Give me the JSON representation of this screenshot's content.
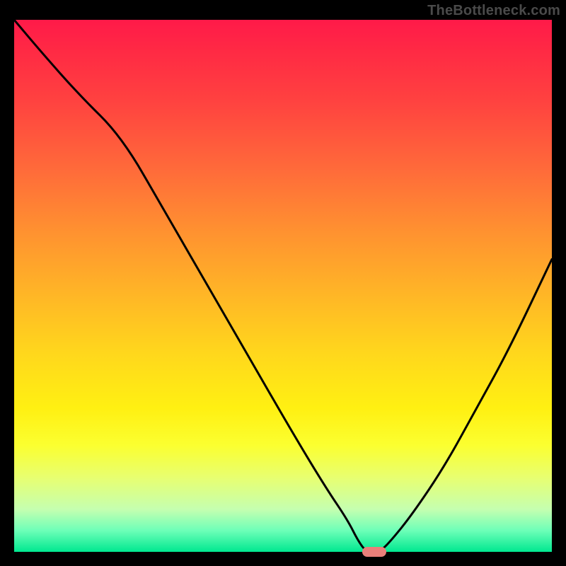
{
  "watermark": "TheBottleneck.com",
  "chart_data": {
    "type": "line",
    "title": "",
    "xlabel": "",
    "ylabel": "",
    "xlim": [
      0,
      100
    ],
    "ylim": [
      0,
      100
    ],
    "x": [
      0,
      5,
      12,
      20,
      28,
      36,
      44,
      52,
      58,
      62,
      64,
      65.5,
      68,
      70,
      74,
      80,
      86,
      92,
      100
    ],
    "values": [
      100,
      94,
      86,
      78,
      64,
      50,
      36,
      22,
      12,
      6,
      2,
      0,
      0,
      2,
      7,
      16,
      27,
      38,
      55
    ],
    "marker": {
      "x": 67,
      "y": 0
    },
    "gradient_stops": [
      {
        "pos": 0,
        "color": "#ff1a49"
      },
      {
        "pos": 50,
        "color": "#ffb726"
      },
      {
        "pos": 80,
        "color": "#fbff30"
      },
      {
        "pos": 100,
        "color": "#00e890"
      }
    ]
  }
}
